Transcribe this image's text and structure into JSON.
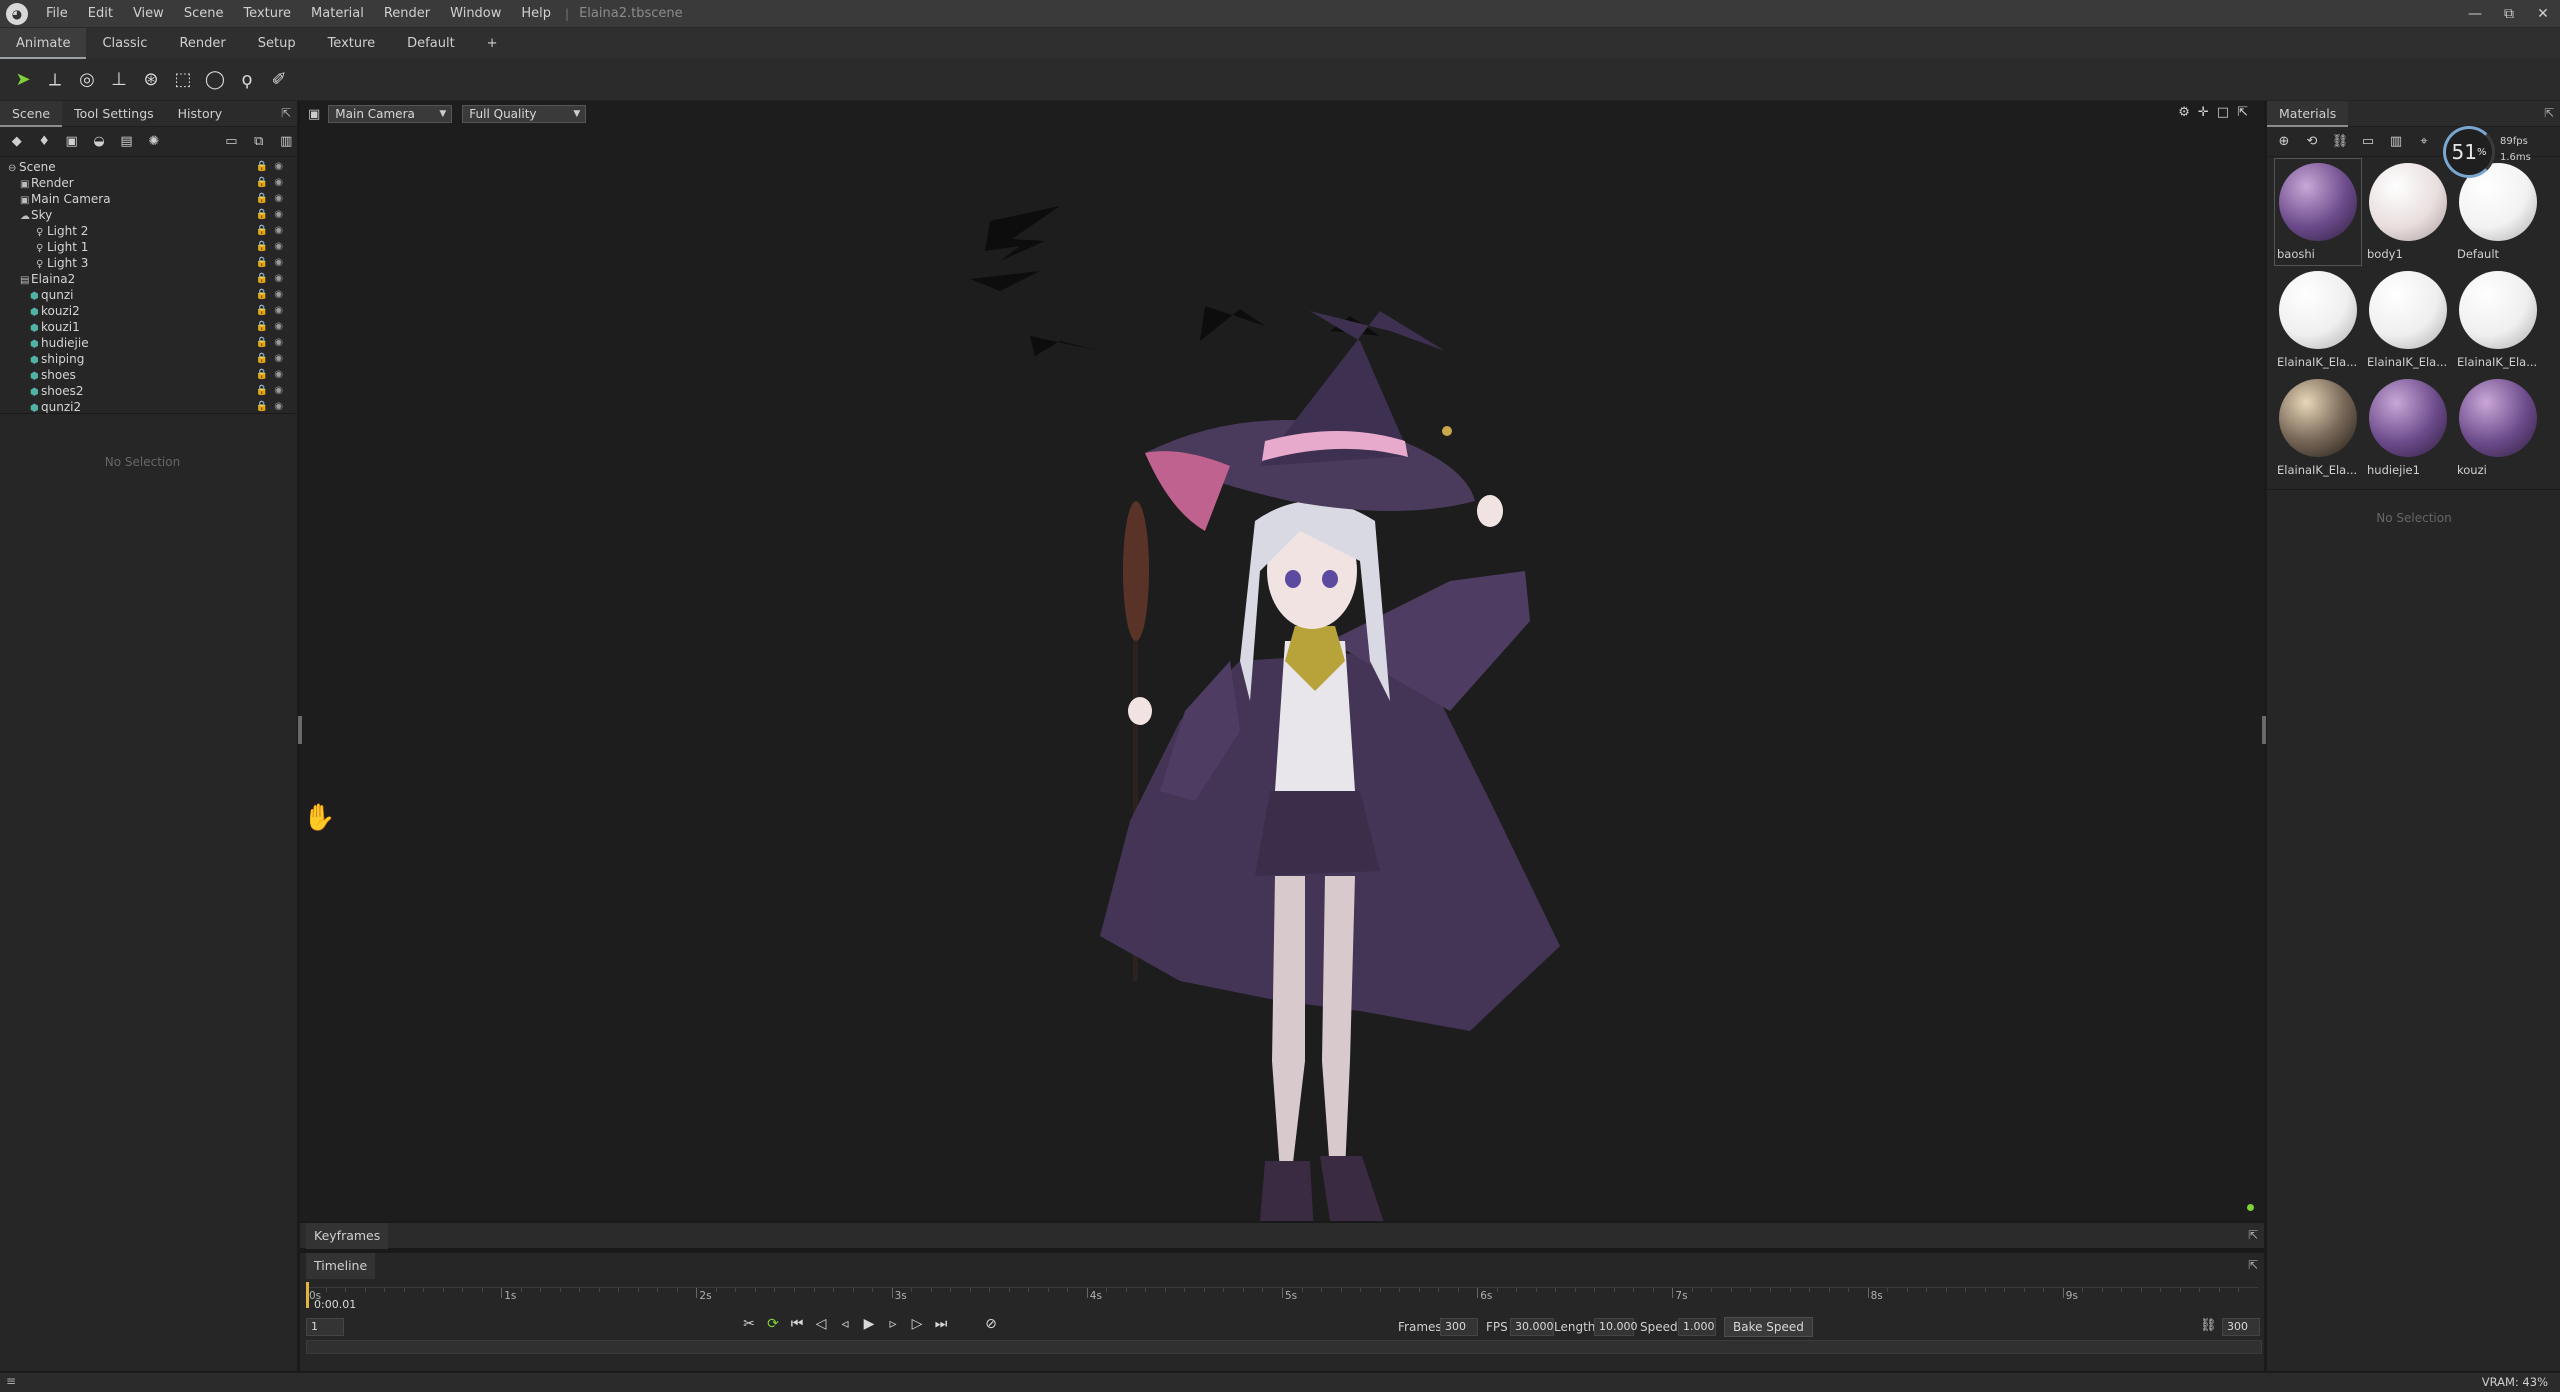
{
  "window": {
    "title": "Elaina2.tbscene",
    "menu": [
      "File",
      "Edit",
      "View",
      "Scene",
      "Texture",
      "Material",
      "Render",
      "Window",
      "Help"
    ],
    "controls": {
      "minimize": "—",
      "maximize": "⧉",
      "close": "✕"
    }
  },
  "workspace_tabs": [
    "Animate",
    "Classic",
    "Render",
    "Setup",
    "Texture",
    "Default",
    "+"
  ],
  "toolbar": {
    "tools": [
      "select-icon",
      "move-icon",
      "rotate-icon",
      "scale-icon",
      "snap-icon",
      "box-select-icon",
      "circle-select-icon",
      "lasso-icon",
      "paint-select-icon"
    ]
  },
  "left_panel": {
    "tabs": [
      "Scene",
      "Tool Settings",
      "History"
    ],
    "tree": [
      {
        "label": "Scene",
        "depth": 0,
        "icon": "scene-icon"
      },
      {
        "label": "Render",
        "depth": 1,
        "icon": "render-icon"
      },
      {
        "label": "Main Camera",
        "depth": 1,
        "icon": "camera-icon"
      },
      {
        "label": "Sky",
        "depth": 1,
        "icon": "sky-icon"
      },
      {
        "label": "Light 2",
        "depth": 2,
        "icon": "light-icon"
      },
      {
        "label": "Light 1",
        "depth": 2,
        "icon": "light-icon"
      },
      {
        "label": "Light 3",
        "depth": 2,
        "icon": "light-icon"
      },
      {
        "label": "Elaina2",
        "depth": 1,
        "icon": "model-icon"
      },
      {
        "label": "qunzi",
        "depth": 2,
        "icon": "mesh-icon"
      },
      {
        "label": "kouzi2",
        "depth": 2,
        "icon": "mesh-icon"
      },
      {
        "label": "kouzi1",
        "depth": 2,
        "icon": "mesh-icon"
      },
      {
        "label": "hudiejie",
        "depth": 2,
        "icon": "mesh-icon"
      },
      {
        "label": "shiping",
        "depth": 2,
        "icon": "mesh-icon"
      },
      {
        "label": "shoes",
        "depth": 2,
        "icon": "mesh-icon"
      },
      {
        "label": "shoes2",
        "depth": 2,
        "icon": "mesh-icon"
      },
      {
        "label": "qunzi2",
        "depth": 2,
        "icon": "mesh-icon"
      }
    ],
    "no_selection": "No Selection"
  },
  "viewport": {
    "camera": "Main Camera",
    "quality": "Full Quality"
  },
  "right_panel": {
    "title": "Materials",
    "materials": [
      {
        "name": "baoshi",
        "color": "#6b4a8a"
      },
      {
        "name": "body1",
        "color": "#e9dede"
      },
      {
        "name": "Default",
        "color": "#f2f2f2"
      },
      {
        "name": "ElainaIK_Ela...",
        "color": "#efefef"
      },
      {
        "name": "ElainaIK_Ela...",
        "color": "#efefef"
      },
      {
        "name": "ElainaIK_Ela...",
        "color": "#efefef"
      },
      {
        "name": "ElainaIK_Ela...",
        "color": "#7a6a5a"
      },
      {
        "name": "hudiejie1",
        "color": "#6b4a8a"
      },
      {
        "name": "kouzi",
        "color": "#6b4a8a"
      }
    ],
    "no_selection": "No Selection",
    "perf": {
      "percent": "51",
      "unit": "%",
      "line1": "89fps",
      "line2": "1.6ms"
    }
  },
  "keyframes": {
    "label": "Keyframes"
  },
  "timeline": {
    "label": "Timeline",
    "time_readout": "0:00.01",
    "current_frame": "1",
    "ticks": [
      "0s",
      "1s",
      "2s",
      "3s",
      "4s",
      "5s",
      "6s",
      "7s",
      "8s",
      "9s"
    ],
    "frames_label": "Frames",
    "frames": "300",
    "fps_label": "FPS",
    "fps": "30.000",
    "length_label": "Length",
    "length": "10.000",
    "speed_label": "Speed",
    "speed": "1.000",
    "bake_label": "Bake Speed",
    "end_frame": "300"
  },
  "status": {
    "vram": "VRAM: 43%"
  }
}
